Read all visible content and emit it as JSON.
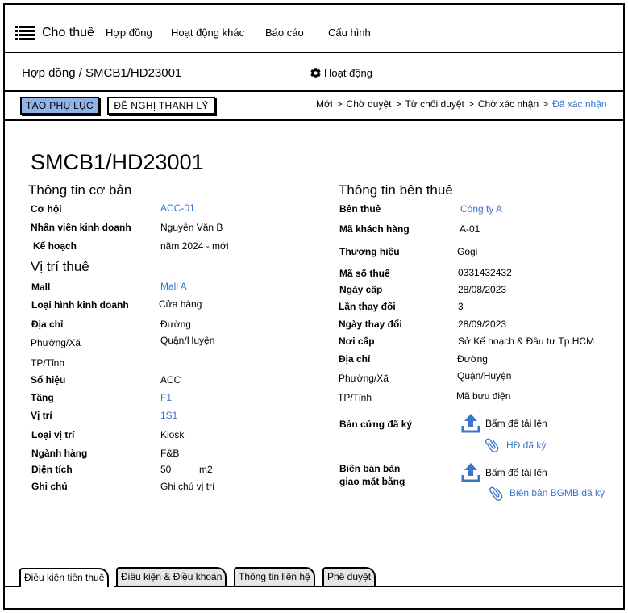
{
  "nav": {
    "app_title": "Cho thuê",
    "items": [
      "Hợp đồng",
      "Hoạt động khác",
      "Báo cáo",
      "Cấu hình"
    ]
  },
  "breadcrumb": "Hợp đồng / SMCB1/HD23001",
  "activity_label": "Hoạt động",
  "actions": {
    "create_appendix": "TẠO PHỤ LỤC",
    "propose_liquidation": "ĐỀ NGHỊ THANH LÝ"
  },
  "status_steps": [
    "Mới",
    "Chờ duyệt",
    "Từ chối duyệt",
    "Chờ xác nhận",
    "Đã xác nhận"
  ],
  "contract_code": "SMCB1/HD23001",
  "basic_info": {
    "heading": "Thông tin cơ bản",
    "opportunity_label": "Cơ hội",
    "opportunity_value": "ACC-01",
    "sales_label": "Nhân viên kinh doanh",
    "sales_value": "Nguyễn Văn B",
    "plan_label": "Kế hoạch",
    "plan_value": "năm 2024 - mới"
  },
  "location": {
    "heading": "Vị trí thuê",
    "mall_label": "Mall",
    "mall_value": "Mall A",
    "business_type_label": "Loại hình kinh doanh",
    "business_type_value": "Cửa hàng",
    "address_label": "Địa chỉ",
    "address_value": "Đường",
    "ward_label": "Phường/Xã",
    "ward_value": "Quận/Huyện",
    "province_label": "TP/Tỉnh",
    "number_label": "Số hiệu",
    "number_value": "ACC",
    "floor_label": "Tầng",
    "floor_value": "F1",
    "position_label": "Vị trí",
    "position_value": "1S1",
    "position_type_label": "Loại vị trí",
    "position_type_value": "Kiosk",
    "industry_label": "Ngành hàng",
    "industry_value": "F&B",
    "area_label": "Diện tích",
    "area_value": "50",
    "area_unit": "m2",
    "note_label": "Ghi chú",
    "note_value": "Ghi chú vị trí"
  },
  "tenant": {
    "heading": "Thông tin bên thuê",
    "tenant_label": "Bên thuê",
    "tenant_value": "Công ty A",
    "customer_code_label": "Mã khách hàng",
    "customer_code_value": "A-01",
    "brand_label": "Thương hiệu",
    "brand_value": "Gogi",
    "tax_code_label": "Mã số thuế",
    "tax_code_value": "0331432432",
    "issue_date_label": "Ngày cấp",
    "issue_date_value": "28/08/2023",
    "change_count_label": "Lần thay đổi",
    "change_count_value": "3",
    "change_date_label": "Ngày thay đổi",
    "change_date_value": "28/09/2023",
    "issuer_label": "Nơi cấp",
    "issuer_value": "Sở Kế hoạch & Đầu tư Tp.HCM",
    "address_label": "Địa chỉ",
    "address_value": "Đường",
    "ward_label": "Phường/Xã",
    "ward_value": "Quận/Huyện",
    "province_label": "TP/Tỉnh",
    "province_value": "Mã bưu điện",
    "signed_copy_label": "Bản cứng đã ký",
    "upload_label_1": "Bấm để tải lên",
    "signed_file": "HĐ đã ký",
    "handover_label_line1": "Biên bản bàn",
    "handover_label_line2": "giao mặt bằng",
    "upload_label_2": "Bấm để tải lên",
    "handover_file": "Biên bản BGMB đã ký"
  },
  "tabs": [
    "Điều kiện tiền thuê",
    "Điều kiện & Điều khoản",
    "Thông tin liên hệ",
    "Phê duyệt"
  ],
  "colors": {
    "link": "#3a76c9",
    "primary_button": "#8fb3e6"
  }
}
